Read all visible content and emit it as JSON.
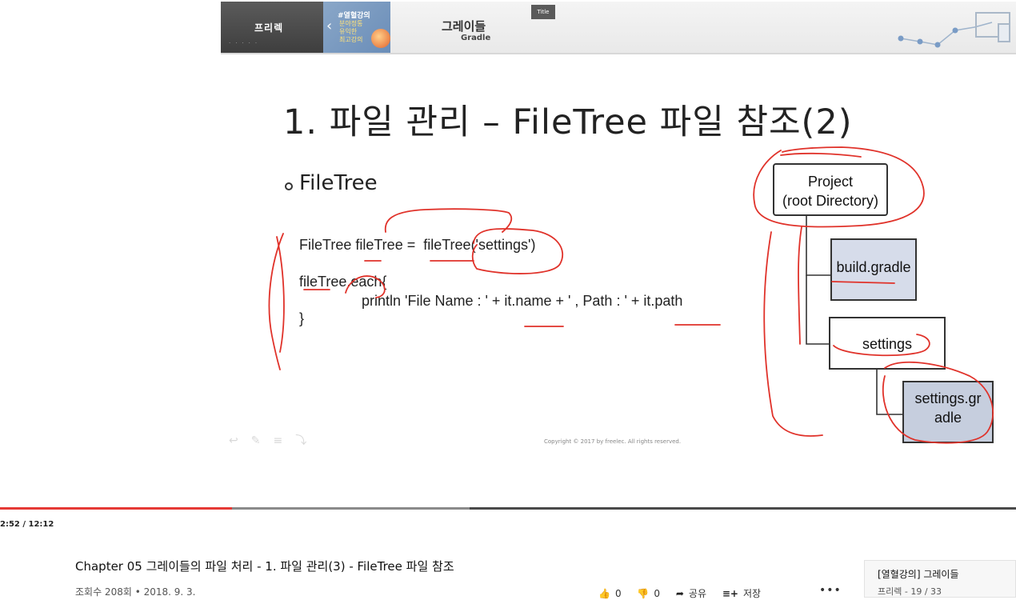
{
  "slide": {
    "brand": "프리렉",
    "promo": {
      "tag": "#열혈강의",
      "lines": [
        "분야정통",
        "유익한",
        "최고강의"
      ]
    },
    "course_title": "그레이들",
    "course_subtitle": "Gradle",
    "title_tab": "Title",
    "title": "1. 파일 관리 – FileTree 파일 참조(2)",
    "bullet": "FileTree",
    "code_lines": [
      "FileTree fileTree =  fileTree('settings')",
      "fileTree.each{",
      "println 'File Name : ' + it.name + ' , Path : ' + it.path",
      "}"
    ],
    "diagram": {
      "project": [
        "Project",
        "(root Directory)"
      ],
      "build_file": "build.gradle",
      "settings_dir": "settings",
      "settings_file": [
        "settings.gr",
        "adle"
      ]
    },
    "copyright": "Copyright © 2017 by freelec. All rights reserved."
  },
  "player": {
    "time": "2:52 / 12:12",
    "progress_fraction": 0.228,
    "buffered_fraction": 0.462,
    "colors": {
      "played": "#e53935",
      "buffered": "#8a8a8a",
      "track": "#4a4a4a"
    }
  },
  "video": {
    "title": "Chapter 05 그레이들의 파일 처리 - 1. 파일 관리(3) - FileTree 파일 참조",
    "meta": "조회수 208회 • 2018. 9. 3.",
    "likes": "0",
    "dislikes": "0",
    "share_label": "공유",
    "save_label": "저장",
    "icons": [
      "thumbs-up-icon",
      "thumbs-down-icon",
      "share-icon",
      "playlist-add-icon",
      "more-icon"
    ]
  },
  "playlist": {
    "title": "[열혈강의] 그레이들",
    "meta": "프리렉 - 19 / 33"
  }
}
